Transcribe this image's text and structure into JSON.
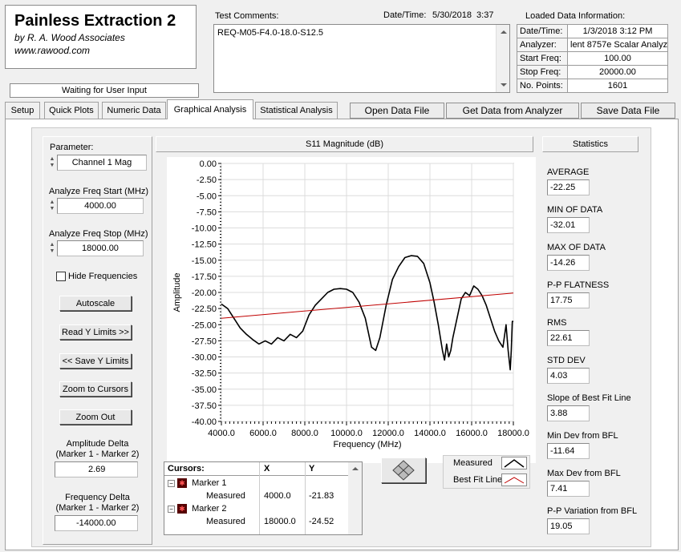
{
  "app": {
    "title": "Painless Extraction 2",
    "byline": "by R. A. Wood Associates",
    "website": "www.rawood.com",
    "status": "Waiting for User Input"
  },
  "comments": {
    "label": "Test Comments:",
    "value": "REQ-M05-F4.0-18.0-S12.5",
    "datetime_label": "Date/Time:",
    "datetime_value": "5/30/2018  3:37"
  },
  "loaded_data": {
    "title": "Loaded Data Information:",
    "rows": [
      {
        "label": "Date/Time:",
        "value": "1/3/2018 3:12 PM"
      },
      {
        "label": "Analyzer:",
        "value": "lent 8757e Scalar Analyz"
      },
      {
        "label": "Start Freq:",
        "value": "100.00"
      },
      {
        "label": "Stop Freq:",
        "value": "20000.00"
      },
      {
        "label": "No. Points:",
        "value": "1601"
      }
    ]
  },
  "tabs": [
    {
      "label": "Setup"
    },
    {
      "label": "Quick Plots"
    },
    {
      "label": "Numeric Data"
    },
    {
      "label": "Graphical Analysis"
    },
    {
      "label": "Statistical Analysis"
    }
  ],
  "actions": {
    "open": "Open Data File",
    "get": "Get Data from Analyzer",
    "save": "Save Data File"
  },
  "controls": {
    "parameter_label": "Parameter:",
    "parameter_value": "Channel 1 Mag",
    "start_label": "Analyze Freq Start (MHz)",
    "start_value": "4000.00",
    "stop_label": "Analyze Freq Stop (MHz)",
    "stop_value": "18000.00",
    "hide_freq": "Hide Frequencies",
    "autoscale": "Autoscale",
    "read_y": "Read Y Limits >>",
    "save_y": "<< Save Y Limits",
    "zoom_cursors": "Zoom to Cursors",
    "zoom_out": "Zoom Out",
    "amp_delta_label": "Amplitude Delta\n(Marker 1 - Marker 2)",
    "amp_delta_l1": "Amplitude Delta",
    "amp_delta_l2": "(Marker 1 - Marker 2)",
    "amp_delta_value": "2.69",
    "freq_delta_l1": "Frequency Delta",
    "freq_delta_l2": "(Marker 1 - Marker 2)",
    "freq_delta_value": "-14000.00"
  },
  "legend": {
    "measured": "Measured",
    "best_fit": "Best Fit Line"
  },
  "cursors": {
    "header": [
      "Cursors:",
      "X",
      "Y"
    ],
    "markers": [
      {
        "name": "Marker 1",
        "sub": "Measured",
        "x": "4000.0",
        "y": "-21.83"
      },
      {
        "name": "Marker 2",
        "sub": "Measured",
        "x": "18000.0",
        "y": "-24.52"
      }
    ]
  },
  "statistics": {
    "title": "Statistics",
    "items": [
      {
        "label": "AVERAGE",
        "value": "-22.25"
      },
      {
        "label": "MIN OF DATA",
        "value": "-32.01"
      },
      {
        "label": "MAX OF DATA",
        "value": "-14.26"
      },
      {
        "label": "P-P FLATNESS",
        "value": "17.75"
      },
      {
        "label": "RMS",
        "value": "22.61"
      },
      {
        "label": "STD DEV",
        "value": "4.03"
      },
      {
        "label": "Slope of Best Fit Line",
        "value": "3.88"
      },
      {
        "label": "Min Dev from BFL",
        "value": "-11.64"
      },
      {
        "label": "Max Dev from BFL",
        "value": "7.41"
      },
      {
        "label": "P-P Variation from BFL",
        "value": "19.05"
      }
    ]
  },
  "chart_data": {
    "type": "line",
    "title": "S11 Magnitude (dB)",
    "xlabel": "Frequency (MHz)",
    "ylabel": "Amplitude",
    "xlim": [
      4000,
      18000
    ],
    "ylim": [
      -40,
      0
    ],
    "xticks": [
      "4000.0",
      "6000.0",
      "8000.0",
      "10000.0",
      "12000.0",
      "14000.0",
      "16000.0",
      "18000.0"
    ],
    "yticks": [
      "0.00",
      "-2.50",
      "-5.00",
      "-7.50",
      "-10.00",
      "-12.50",
      "-15.00",
      "-17.50",
      "-20.00",
      "-22.50",
      "-25.00",
      "-27.50",
      "-30.00",
      "-32.50",
      "-35.00",
      "-37.50",
      "-40.00"
    ],
    "grid": true,
    "series": [
      {
        "name": "Measured",
        "color": "#000000",
        "x": [
          4000,
          4300,
          4600,
          4900,
          5200,
          5500,
          5800,
          6100,
          6400,
          6700,
          7000,
          7300,
          7600,
          7900,
          8200,
          8500,
          8800,
          9100,
          9400,
          9700,
          10000,
          10300,
          10600,
          10900,
          11200,
          11400,
          11600,
          11900,
          12200,
          12500,
          12800,
          13100,
          13400,
          13700,
          14000,
          14200,
          14400,
          14600,
          14700,
          14800,
          14900,
          15000,
          15100,
          15300,
          15500,
          15700,
          15900,
          16100,
          16300,
          16500,
          16700,
          16900,
          17100,
          17300,
          17500,
          17650,
          17750,
          17850,
          17900,
          17950,
          18000
        ],
        "y": [
          -21.8,
          -22.5,
          -24.0,
          -25.5,
          -26.5,
          -27.3,
          -28.0,
          -27.5,
          -28.0,
          -27.0,
          -27.5,
          -26.5,
          -27.0,
          -26.0,
          -23.5,
          -22.0,
          -21.0,
          -20.0,
          -19.5,
          -19.4,
          -19.5,
          -20.0,
          -21.5,
          -24.0,
          -28.5,
          -29.0,
          -27.0,
          -22.0,
          -18.0,
          -16.0,
          -14.6,
          -14.3,
          -14.4,
          -15.5,
          -18.5,
          -21.5,
          -25.0,
          -29.0,
          -30.5,
          -28.0,
          -30.0,
          -29.0,
          -27.0,
          -24.0,
          -21.0,
          -20.0,
          -20.5,
          -19.0,
          -19.5,
          -20.5,
          -22.0,
          -24.0,
          -26.0,
          -27.5,
          -28.5,
          -25.0,
          -29.0,
          -32.0,
          -29.0,
          -24.5,
          -24.5
        ]
      },
      {
        "name": "Best Fit Line",
        "color": "#c00000",
        "x": [
          4000,
          18000
        ],
        "y": [
          -24.0,
          -20.1
        ]
      }
    ]
  }
}
